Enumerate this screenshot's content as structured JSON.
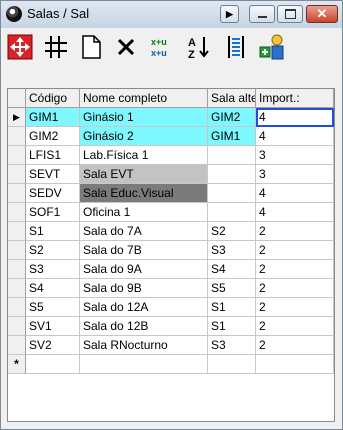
{
  "window": {
    "title": "Salas / Sal"
  },
  "toolbar": {
    "tools": [
      {
        "icon": "navigate-icon"
      },
      {
        "icon": "grid-icon"
      },
      {
        "icon": "new-record-icon"
      },
      {
        "icon": "delete-icon"
      },
      {
        "icon": "transpose-icon"
      },
      {
        "icon": "sort-az-icon"
      },
      {
        "icon": "column-icon"
      },
      {
        "icon": "assign-icon"
      }
    ]
  },
  "grid": {
    "columns": [
      "Código",
      "Nome completo",
      "Sala alte",
      "Import.:"
    ],
    "current_row_marker": "▶",
    "new_row_marker": "*",
    "rows": [
      {
        "code": "GIM1",
        "name": "Ginásio 1",
        "alt": "GIM2",
        "imp": "4"
      },
      {
        "code": "GIM2",
        "name": "Ginásio 2",
        "alt": "GIM1",
        "imp": "4"
      },
      {
        "code": "LFIS1",
        "name": "Lab.Física 1",
        "alt": "",
        "imp": "3"
      },
      {
        "code": "SEVT",
        "name": "Sala EVT",
        "alt": "",
        "imp": "3"
      },
      {
        "code": "SEDV",
        "name": "Sala Educ.Visual",
        "alt": "",
        "imp": "4"
      },
      {
        "code": "SOF1",
        "name": "Oficina 1",
        "alt": "",
        "imp": "4"
      },
      {
        "code": "S1",
        "name": "Sala do 7A",
        "alt": "S2",
        "imp": "2"
      },
      {
        "code": "S2",
        "name": "Sala do 7B",
        "alt": "S3",
        "imp": "2"
      },
      {
        "code": "S3",
        "name": "Sala do 9A",
        "alt": "S4",
        "imp": "2"
      },
      {
        "code": "S4",
        "name": "Sala do 9B",
        "alt": "S5",
        "imp": "2"
      },
      {
        "code": "S5",
        "name": "Sala do 12A",
        "alt": "S1",
        "imp": "2"
      },
      {
        "code": "SV1",
        "name": "Sala do 12B",
        "alt": "S1",
        "imp": "2"
      },
      {
        "code": "SV2",
        "name": "Sala RNocturno",
        "alt": "S3",
        "imp": "2"
      }
    ]
  }
}
